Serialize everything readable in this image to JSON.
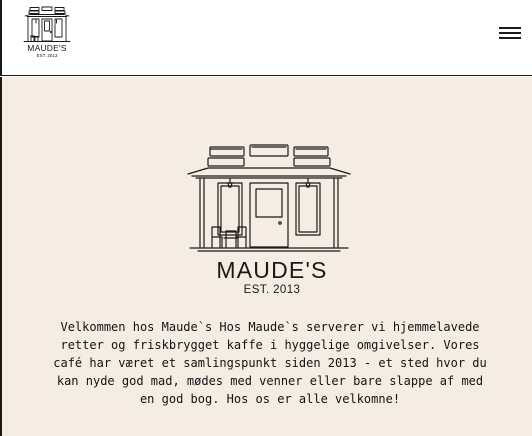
{
  "header": {
    "logo": {
      "name": "MAUDE'S",
      "est": "EST. 2013"
    },
    "menu_icon": "hamburger-menu-icon"
  },
  "hero": {
    "logo": {
      "name": "MAUDE'S",
      "est": "EST. 2013"
    },
    "intro_text": "Velkommen hos Maude`s Hos Maude`s serverer vi hjemmelavede retter og friskbrygget kaffe i hyggelige omgivelser. Vores café har været et samlingspunkt siden 2013 - et sted hvor du kan nyde god mad, mødes med venner eller bare slappe af med en god bog. Hos os er alle velkomne!"
  },
  "colors": {
    "header_background": "#ffffff",
    "hero_background": "#f5ece3",
    "ink": "#1a1a1a"
  }
}
